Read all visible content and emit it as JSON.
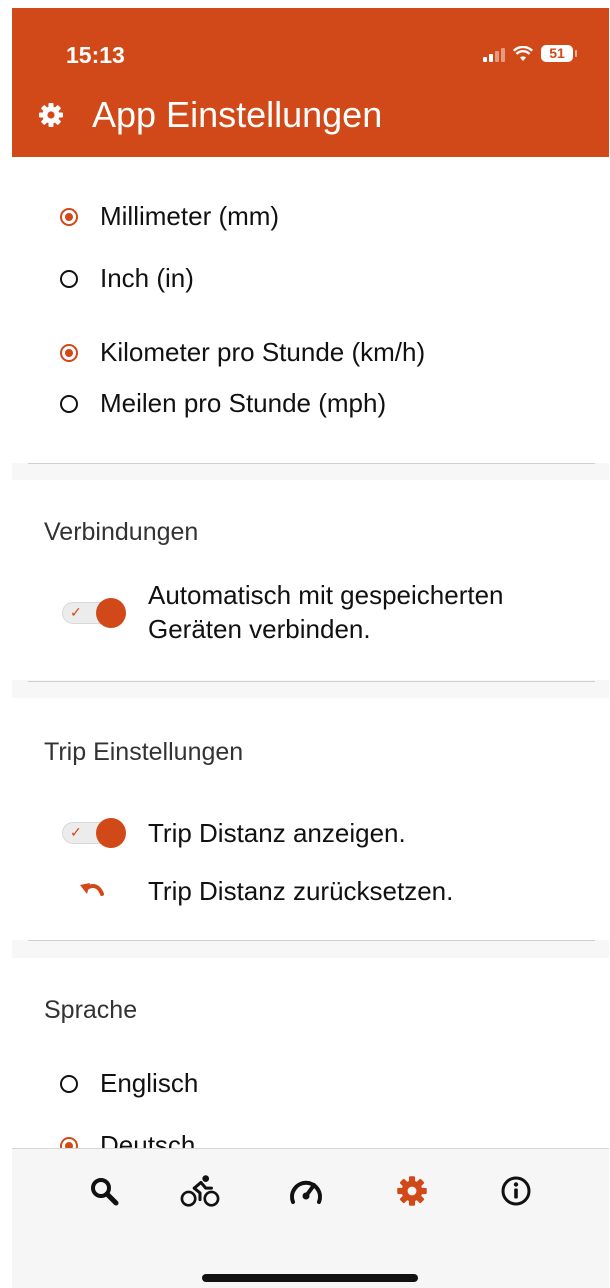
{
  "status": {
    "time": "15:13",
    "battery": "51"
  },
  "header": {
    "title": "App Einstellungen",
    "icon": "gear-icon"
  },
  "units": {
    "length": [
      {
        "label": "Millimeter (mm)",
        "selected": true
      },
      {
        "label": "Inch (in)",
        "selected": false
      }
    ],
    "speed": [
      {
        "label": "Kilometer pro Stunde (km/h)",
        "selected": true
      },
      {
        "label": "Meilen pro Stunde (mph)",
        "selected": false
      }
    ]
  },
  "connections": {
    "heading": "Verbindungen",
    "auto_connect": {
      "line1": "Automatisch mit gespeicherten",
      "line2": "Geräten verbinden.",
      "enabled": true
    }
  },
  "trip": {
    "heading": "Trip Einstellungen",
    "show_distance": {
      "label": "Trip Distanz anzeigen.",
      "enabled": true
    },
    "reset_distance": {
      "label": "Trip Distanz zurücksetzen.",
      "icon": "undo-icon"
    }
  },
  "language": {
    "heading": "Sprache",
    "options": [
      {
        "label": "Englisch",
        "selected": false
      },
      {
        "label": "Deutsch",
        "selected": true
      }
    ]
  },
  "tabbar": {
    "tabs": [
      {
        "icon": "search-icon",
        "active": false
      },
      {
        "icon": "bicycle-icon",
        "active": false
      },
      {
        "icon": "speedometer-icon",
        "active": false
      },
      {
        "icon": "gear-icon",
        "active": true
      },
      {
        "icon": "info-icon",
        "active": false
      }
    ]
  },
  "colors": {
    "accent": "#d24919",
    "background": "#f7f7f7",
    "text": "#111111"
  }
}
